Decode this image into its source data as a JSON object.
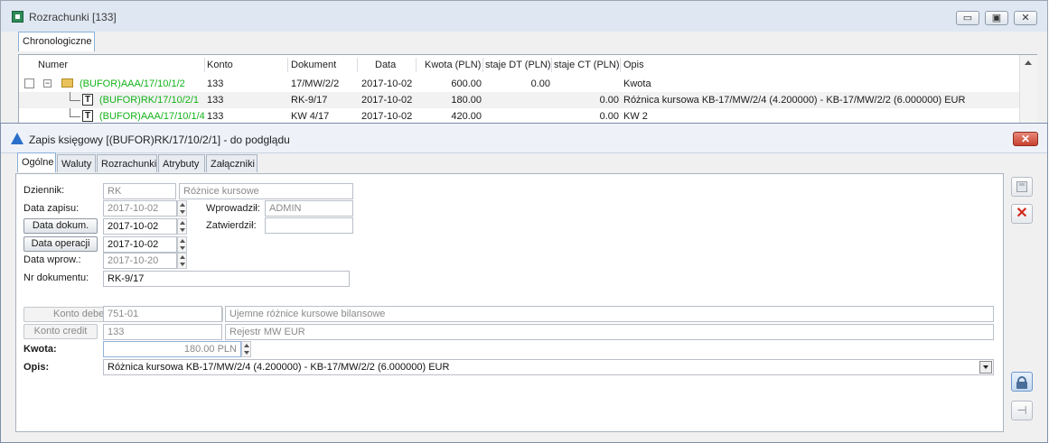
{
  "window1": {
    "title": "Rozrachunki [133]",
    "tab": "Chronologiczne",
    "columns": [
      "Numer",
      "Konto",
      "Dokument",
      "Data",
      "Kwota (PLN)",
      "staje DT (PLN)",
      "staje CT (PLN)",
      "Opis"
    ],
    "rows": [
      {
        "numer": "(BUFOR)AAA/17/10/1/2",
        "konto": "133",
        "dokument": "17/MW/2/2",
        "data": "2017-10-02",
        "kwota": "600.00",
        "dt": "0.00",
        "ct": "",
        "opis": "Kwota"
      },
      {
        "numer": "(BUFOR)RK/17/10/2/1",
        "konto": "133",
        "dokument": "RK-9/17",
        "data": "2017-10-02",
        "kwota": "180.00",
        "dt": "",
        "ct": "0.00",
        "opis": "Różnica kursowa KB-17/MW/2/4 (4.200000) - KB-17/MW/2/2 (6.000000) EUR"
      },
      {
        "numer": "(BUFOR)AAA/17/10/1/4",
        "konto": "133",
        "dokument": "KW 4/17",
        "data": "2017-10-02",
        "kwota": "420.00",
        "dt": "",
        "ct": "0.00",
        "opis": "KW 2"
      }
    ]
  },
  "window2": {
    "title": "Zapis księgowy [(BUFOR)RK/17/10/2/1] - do podglądu",
    "tabs": [
      "Ogólne",
      "Waluty",
      "Rozrachunki",
      "Atrybuty",
      "Załączniki"
    ],
    "form": {
      "dziennik_label": "Dziennik:",
      "dziennik_value": "RK",
      "dziennik_desc": "Różnice kursowe",
      "data_zapisu_label": "Data zapisu:",
      "data_zapisu_value": "2017-10-02",
      "wprowadzil_label": "Wprowadził:",
      "wprowadzil_value": "ADMIN",
      "data_dokum_button": "Data dokum.",
      "data_dokum_value": "2017-10-02",
      "zatwierdzil_label": "Zatwierdził:",
      "zatwierdzil_value": "",
      "data_operacji_button": "Data operacji",
      "data_operacji_value": "2017-10-02",
      "data_wprow_label": "Data wprow.:",
      "data_wprow_value": "2017-10-20",
      "nr_dokumentu_label": "Nr dokumentu:",
      "nr_dokumentu_value": "RK-9/17",
      "konto_debet_button": "Konto debet",
      "konto_debet_value": "751-01",
      "konto_debet_desc": "Ujemne różnice kursowe bilansowe",
      "konto_credit_button": "Konto credit",
      "konto_credit_value": "133",
      "konto_credit_desc": "Rejestr MW EUR",
      "kwota_label": "Kwota:",
      "kwota_value": "180.00 PLN",
      "opis_label": "Opis:",
      "opis_value": "Różnica kursowa KB-17/MW/2/4 (4.200000) - KB-17/MW/2/2 (6.000000) EUR"
    }
  },
  "icons": [
    "app-icon",
    "minimize-icon",
    "maximize-icon",
    "close-icon",
    "folder-icon",
    "document-icon",
    "save-icon",
    "cancel-icon",
    "lock-icon",
    "pin-icon"
  ],
  "colors": {
    "accent": "#2a6fc9",
    "bufor_green": "#14b31a",
    "close_red": "#c9412f"
  }
}
